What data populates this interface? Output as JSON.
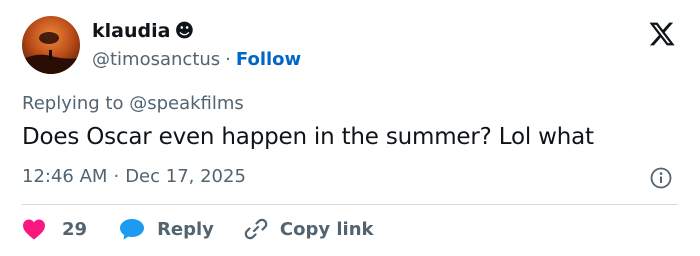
{
  "author": {
    "name": "klaudia",
    "name_emoji": "☻",
    "handle": "@timosanctus",
    "separator": "·",
    "follow_label": "Follow"
  },
  "tweet": {
    "replying_to": "Replying to @speakfilms",
    "text": "Does Oscar even happen in the summer? Lol what",
    "time": "12:46 AM",
    "separator": "·",
    "date": "Dec 17, 2025"
  },
  "actions": {
    "like_count": "29",
    "reply_label": "Reply",
    "copy_link_label": "Copy link"
  },
  "icons": {
    "brand": "x-logo-icon",
    "info": "info-icon",
    "like": "heart-icon",
    "reply": "speech-bubble-icon",
    "copy": "link-icon"
  },
  "colors": {
    "text": "#0f1419",
    "secondary": "#536471",
    "link": "#0067c8",
    "like": "#f91880",
    "reply": "#1d9bf0",
    "divider": "#cfd9de"
  }
}
